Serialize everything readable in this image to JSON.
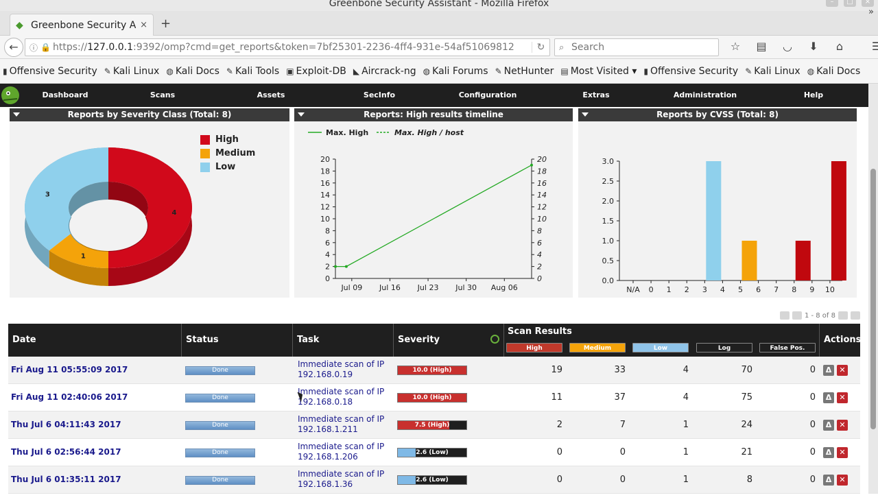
{
  "window": {
    "title": "Greenbone Security Assistant - Mozilla Firefox"
  },
  "tab": {
    "title": "Greenbone Security A...",
    "close": "×",
    "new": "+"
  },
  "nav": {
    "url_prefix": "https://",
    "url_host": "127.0.0.1",
    "url_rest": ":9392/omp?cmd=get_reports&token=7bf25301-2236-4ff4-931e-54af51069812",
    "search_placeholder": "Search"
  },
  "bookmarks": [
    {
      "label": "Offensive Security",
      "icon": "offsec-icon"
    },
    {
      "label": "Kali Linux",
      "icon": "kali-icon"
    },
    {
      "label": "Kali Docs",
      "icon": "kali-docs-icon"
    },
    {
      "label": "Kali Tools",
      "icon": "kali-tools-icon"
    },
    {
      "label": "Exploit-DB",
      "icon": "exploit-db-icon"
    },
    {
      "label": "Aircrack-ng",
      "icon": "aircrack-icon"
    },
    {
      "label": "Kali Forums",
      "icon": "forums-icon"
    },
    {
      "label": "NetHunter",
      "icon": "nethunter-icon"
    },
    {
      "label": "Most Visited ▾",
      "icon": "folder-icon"
    },
    {
      "label": "Offensive Security",
      "icon": "offsec-icon"
    },
    {
      "label": "Kali Linux",
      "icon": "kali-icon"
    },
    {
      "label": "Kali Docs",
      "icon": "kali-docs-icon"
    }
  ],
  "menu": [
    "Dashboard",
    "Scans",
    "Assets",
    "SecInfo",
    "Configuration",
    "Extras",
    "Administration",
    "Help"
  ],
  "panels": {
    "severity_class": {
      "title": "Reports by Severity Class (Total: 8)",
      "legend": [
        {
          "label": "High",
          "color": "#d1091b"
        },
        {
          "label": "Medium",
          "color": "#f4a30a"
        },
        {
          "label": "Low",
          "color": "#8fd0ec"
        }
      ],
      "labels": {
        "high": "4",
        "medium": "1",
        "low": "3"
      }
    },
    "timeline": {
      "title": "Reports: High results timeline",
      "legend": [
        "Max. High",
        "Max. High / host"
      ]
    },
    "cvss": {
      "title": "Reports by CVSS (Total: 8)"
    }
  },
  "chart_data": [
    {
      "type": "pie",
      "title": "Reports by Severity Class (Total: 8)",
      "categories": [
        "High",
        "Medium",
        "Low"
      ],
      "values": [
        4,
        1,
        3
      ],
      "colors": [
        "#d1091b",
        "#f4a30a",
        "#8fd0ec"
      ]
    },
    {
      "type": "line",
      "title": "Reports: High results timeline",
      "x_ticks": [
        "Jul 09",
        "Jul 16",
        "Jul 23",
        "Jul 30",
        "Aug 06"
      ],
      "y_ticks": [
        "0",
        "2",
        "4",
        "6",
        "8",
        "10",
        "12",
        "14",
        "16",
        "18",
        "20"
      ],
      "ylim": [
        0,
        20
      ],
      "series": [
        {
          "name": "Max. High",
          "x": [
            "2017-07-06",
            "2017-07-08",
            "2017-08-11"
          ],
          "values": [
            2,
            2,
            19
          ]
        },
        {
          "name": "Max. High / host",
          "values": []
        }
      ]
    },
    {
      "type": "bar",
      "title": "Reports by CVSS (Total: 8)",
      "categories": [
        "N/A",
        "0",
        "1",
        "2",
        "3",
        "4",
        "5",
        "6",
        "7",
        "8",
        "9",
        "10"
      ],
      "values": [
        0,
        0,
        0,
        0,
        3,
        0,
        1,
        0,
        0,
        1,
        0,
        3
      ],
      "colors": [
        "#ccc",
        "#ccc",
        "#ccc",
        "#ccc",
        "#8fd0ec",
        "#ccc",
        "#f4a30a",
        "#ccc",
        "#ccc",
        "#c0080e",
        "#ccc",
        "#c0080e"
      ],
      "y_ticks": [
        "0.0",
        "0.5",
        "1.0",
        "1.5",
        "2.0",
        "2.5",
        "3.0"
      ],
      "ylim": [
        0,
        3
      ]
    }
  ],
  "pager": {
    "text": "1 - 8 of 8"
  },
  "table": {
    "headers": {
      "date": "Date",
      "status": "Status",
      "task": "Task",
      "severity": "Severity",
      "scan_results": "Scan Results",
      "actions": "Actions"
    },
    "result_cols": [
      {
        "label": "High",
        "color": "#c0392b"
      },
      {
        "label": "Medium",
        "color": "#f4a30a"
      },
      {
        "label": "Low",
        "color": "#8fc3e8"
      },
      {
        "label": "Log",
        "color": "#1f1f1f"
      },
      {
        "label": "False Pos.",
        "color": "#1f1f1f"
      }
    ],
    "rows": [
      {
        "date": "Fri Aug 11 05:55:09 2017",
        "status": "Done",
        "task_line1": "Immediate scan of IP",
        "task_line2": "192.168.0.19",
        "severity": "10.0 (High)",
        "sev_value": 10.0,
        "sev_color": "#c8302e",
        "high": "19",
        "medium": "33",
        "low": "4",
        "log": "70",
        "fp": "0"
      },
      {
        "date": "Fri Aug 11 02:40:06 2017",
        "status": "Done",
        "task_line1": "Immediate scan of IP",
        "task_line2": "192.168.0.18",
        "severity": "10.0 (High)",
        "sev_value": 10.0,
        "sev_color": "#c8302e",
        "high": "11",
        "medium": "37",
        "low": "4",
        "log": "75",
        "fp": "0"
      },
      {
        "date": "Thu Jul 6 04:11:43 2017",
        "status": "Done",
        "task_line1": "Immediate scan of IP",
        "task_line2": "192.168.1.211",
        "severity": "7.5 (High)",
        "sev_value": 7.5,
        "sev_color": "#c8302e",
        "high": "2",
        "medium": "7",
        "low": "1",
        "log": "24",
        "fp": "0"
      },
      {
        "date": "Thu Jul 6 02:56:44 2017",
        "status": "Done",
        "task_line1": "Immediate scan of IP",
        "task_line2": "192.168.1.206",
        "severity": "2.6 (Low)",
        "sev_value": 2.6,
        "sev_color": "#7fb9e6",
        "high": "0",
        "medium": "0",
        "low": "1",
        "log": "21",
        "fp": "0"
      },
      {
        "date": "Thu Jul 6 01:35:11 2017",
        "status": "Done",
        "task_line1": "Immediate scan of IP",
        "task_line2": "192.168.1.36",
        "severity": "2.6 (Low)",
        "sev_value": 2.6,
        "sev_color": "#7fb9e6",
        "high": "0",
        "medium": "0",
        "low": "1",
        "log": "8",
        "fp": "0"
      }
    ]
  }
}
